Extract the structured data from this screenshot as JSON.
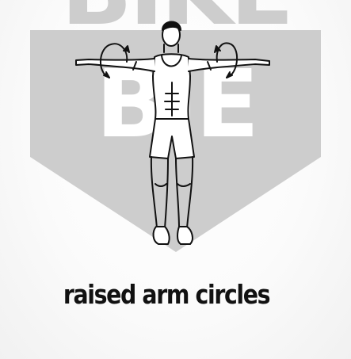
{
  "exercise": {
    "name": "raised arm circles"
  },
  "watermark": {
    "text_top": "BIKE",
    "text_bottom": "BIE",
    "icon": "shield-logo-icon",
    "color": "#c8c8c8"
  },
  "illustration": {
    "icon": "person-arm-circles-icon",
    "rotation_arrow_icon": "circular-arrow-icon",
    "line_color": "#111111"
  }
}
